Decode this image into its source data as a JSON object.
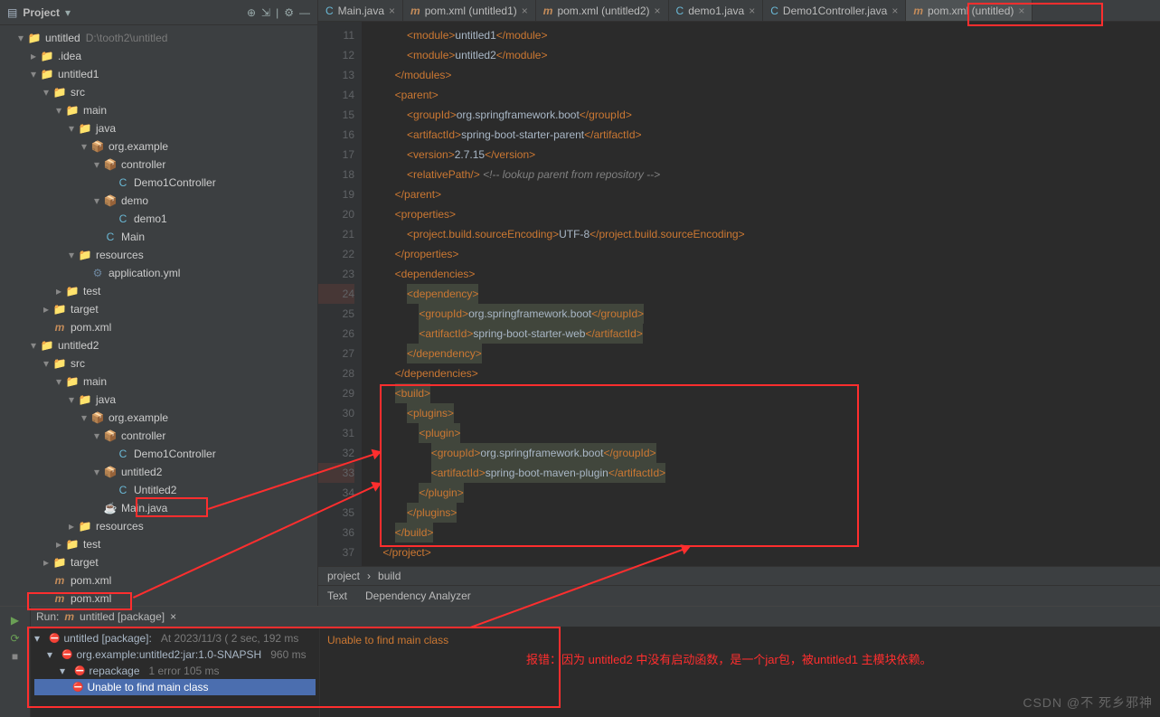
{
  "sidebar": {
    "title": "Project",
    "root": "untitled",
    "root_path": "D:\\tooth2\\untitled",
    "items": [
      {
        "ind": 0,
        "arrow": "▾",
        "icon": "📁",
        "iconCls": "folder-blue",
        "label": "untitled",
        "suffix": "D:\\tooth2\\untitled"
      },
      {
        "ind": 1,
        "arrow": "▸",
        "icon": "📁",
        "iconCls": "folder-blue",
        "label": ".idea"
      },
      {
        "ind": 1,
        "arrow": "▾",
        "icon": "📁",
        "iconCls": "folder-blue",
        "label": "untitled1"
      },
      {
        "ind": 2,
        "arrow": "▾",
        "icon": "📁",
        "iconCls": "folder-blue",
        "label": "src"
      },
      {
        "ind": 3,
        "arrow": "▾",
        "icon": "📁",
        "iconCls": "folder-blue",
        "label": "main"
      },
      {
        "ind": 4,
        "arrow": "▾",
        "icon": "📁",
        "iconCls": "folder-blue",
        "label": "java"
      },
      {
        "ind": 5,
        "arrow": "▾",
        "icon": "📦",
        "iconCls": "pkg",
        "label": "org.example"
      },
      {
        "ind": 6,
        "arrow": "▾",
        "icon": "📦",
        "iconCls": "pkg",
        "label": "controller"
      },
      {
        "ind": 7,
        "arrow": "",
        "icon": "C",
        "iconCls": "file-c",
        "label": "Demo1Controller"
      },
      {
        "ind": 6,
        "arrow": "▾",
        "icon": "📦",
        "iconCls": "pkg",
        "label": "demo"
      },
      {
        "ind": 7,
        "arrow": "",
        "icon": "C",
        "iconCls": "file-c",
        "label": "demo1"
      },
      {
        "ind": 6,
        "arrow": "",
        "icon": "C",
        "iconCls": "file-c",
        "label": "Main"
      },
      {
        "ind": 4,
        "arrow": "▾",
        "icon": "📁",
        "iconCls": "folder-org",
        "label": "resources"
      },
      {
        "ind": 5,
        "arrow": "",
        "icon": "⚙",
        "iconCls": "file-j",
        "label": "application.yml"
      },
      {
        "ind": 3,
        "arrow": "▸",
        "icon": "📁",
        "iconCls": "folder-blue",
        "label": "test"
      },
      {
        "ind": 2,
        "arrow": "▸",
        "icon": "📁",
        "iconCls": "folder-org",
        "label": "target"
      },
      {
        "ind": 2,
        "arrow": "",
        "icon": "m",
        "iconCls": "file-m",
        "label": "pom.xml"
      },
      {
        "ind": 1,
        "arrow": "▾",
        "icon": "📁",
        "iconCls": "folder-blue",
        "label": "untitled2"
      },
      {
        "ind": 2,
        "arrow": "▾",
        "icon": "📁",
        "iconCls": "folder-blue",
        "label": "src"
      },
      {
        "ind": 3,
        "arrow": "▾",
        "icon": "📁",
        "iconCls": "folder-blue",
        "label": "main"
      },
      {
        "ind": 4,
        "arrow": "▾",
        "icon": "📁",
        "iconCls": "folder-blue",
        "label": "java"
      },
      {
        "ind": 5,
        "arrow": "▾",
        "icon": "📦",
        "iconCls": "pkg",
        "label": "org.example"
      },
      {
        "ind": 6,
        "arrow": "▾",
        "icon": "📦",
        "iconCls": "pkg",
        "label": "controller"
      },
      {
        "ind": 7,
        "arrow": "",
        "icon": "C",
        "iconCls": "file-c",
        "label": "Demo1Controller"
      },
      {
        "ind": 6,
        "arrow": "▾",
        "icon": "📦",
        "iconCls": "pkg",
        "label": "untitled2"
      },
      {
        "ind": 7,
        "arrow": "",
        "icon": "C",
        "iconCls": "file-c",
        "label": "Untitled2"
      },
      {
        "ind": 6,
        "arrow": "",
        "icon": "☕",
        "iconCls": "file-j",
        "label": "Main.java"
      },
      {
        "ind": 4,
        "arrow": "▸",
        "icon": "📁",
        "iconCls": "folder-org",
        "label": "resources"
      },
      {
        "ind": 3,
        "arrow": "▸",
        "icon": "📁",
        "iconCls": "folder-blue",
        "label": "test"
      },
      {
        "ind": 2,
        "arrow": "▸",
        "icon": "📁",
        "iconCls": "folder-org",
        "label": "target"
      },
      {
        "ind": 2,
        "arrow": "",
        "icon": "m",
        "iconCls": "file-m",
        "label": "pom.xml"
      },
      {
        "ind": 2,
        "arrow": "",
        "icon": "m",
        "iconCls": "file-m",
        "label": "pom.xml"
      }
    ]
  },
  "tabs": [
    {
      "icon": "C",
      "iconCls": "file-c",
      "label": "Main.java"
    },
    {
      "icon": "m",
      "iconCls": "file-m",
      "label": "pom.xml (untitled1)"
    },
    {
      "icon": "m",
      "iconCls": "file-m",
      "label": "pom.xml (untitled2)"
    },
    {
      "icon": "C",
      "iconCls": "file-c",
      "label": "demo1.java"
    },
    {
      "icon": "C",
      "iconCls": "file-c",
      "label": "Demo1Controller.java"
    },
    {
      "icon": "m",
      "iconCls": "file-m",
      "label": "pom.xml (untitled)",
      "active": true
    }
  ],
  "code": {
    "startLine": 11,
    "lines": [
      {
        "n": 11,
        "html": "            <span class=t-tag>&lt;module&gt;</span>untitled1<span class=t-tag>&lt;/module&gt;</span>"
      },
      {
        "n": 12,
        "html": "            <span class=t-tag>&lt;module&gt;</span>untitled2<span class=t-tag>&lt;/module&gt;</span>"
      },
      {
        "n": 13,
        "html": "        <span class=t-tag>&lt;/modules&gt;</span>"
      },
      {
        "n": 14,
        "html": "        <span class=t-tag>&lt;parent&gt;</span>"
      },
      {
        "n": 15,
        "html": "            <span class=t-tag>&lt;groupId&gt;</span>org.springframework.boot<span class=t-tag>&lt;/groupId&gt;</span>"
      },
      {
        "n": 16,
        "html": "            <span class=t-tag>&lt;artifactId&gt;</span>spring-boot-starter-parent<span class=t-tag>&lt;/artifactId&gt;</span>"
      },
      {
        "n": 17,
        "html": "            <span class=t-tag>&lt;version&gt;</span>2.7.15<span class=t-tag>&lt;/version&gt;</span>"
      },
      {
        "n": 18,
        "html": "            <span class=t-tag>&lt;relativePath/&gt;</span> <span class=t-cmt>&lt;!-- lookup parent from repository --&gt;</span>"
      },
      {
        "n": 19,
        "html": "        <span class=t-tag>&lt;/parent&gt;</span>"
      },
      {
        "n": 20,
        "html": "        <span class=t-tag>&lt;properties&gt;</span>"
      },
      {
        "n": 21,
        "html": "            <span class=t-tag>&lt;project.build.sourceEncoding&gt;</span>UTF-8<span class=t-tag>&lt;/project.build.sourceEncoding&gt;</span>"
      },
      {
        "n": 22,
        "html": "        <span class=t-tag>&lt;/properties&gt;</span>"
      },
      {
        "n": 23,
        "html": "        <span class=t-tag>&lt;dependencies&gt;</span>"
      },
      {
        "n": 24,
        "html": "            <span class='hl'><span class=t-tag>&lt;dependency&gt;</span></span>"
      },
      {
        "n": 25,
        "html": "                <span class='hl'><span class=t-tag>&lt;groupId&gt;</span>org.springframework.boot<span class=t-tag>&lt;/groupId&gt;</span></span>"
      },
      {
        "n": 26,
        "html": "                <span class='hl'><span class=t-tag>&lt;artifactId&gt;</span>spring-boot-starter-web<span class=t-tag>&lt;/artifactId&gt;</span></span>"
      },
      {
        "n": 27,
        "html": "            <span class='hl'><span class=t-tag>&lt;/dependency&gt;</span></span>"
      },
      {
        "n": 28,
        "html": "        <span class=t-tag>&lt;/dependencies&gt;</span>"
      },
      {
        "n": 29,
        "html": "        <span class='hl'><span class=t-tag>&lt;build&gt;</span></span>"
      },
      {
        "n": 30,
        "html": "            <span class='hl'><span class=t-tag>&lt;plugins&gt;</span></span>"
      },
      {
        "n": 31,
        "html": "                <span class='hl'><span class=t-tag>&lt;plugin&gt;</span></span>"
      },
      {
        "n": 32,
        "html": "                    <span class='hl'><span class=t-tag>&lt;groupId&gt;</span>org.springframework.boot<span class=t-tag>&lt;/groupId&gt;</span></span>"
      },
      {
        "n": 33,
        "html": "                    <span class='hl'><span class=t-tag>&lt;artifactId&gt;</span>spring-boot-maven-plugin<span class=t-tag>&lt;/artifactId&gt;</span></span>"
      },
      {
        "n": 34,
        "html": "                <span class='hl'><span class=t-tag>&lt;/plugin&gt;</span></span>"
      },
      {
        "n": 35,
        "html": "            <span class='hl'><span class=t-tag>&lt;/plugins&gt;</span></span>"
      },
      {
        "n": 36,
        "html": "        <span class='hl'><span class=t-tag>&lt;/build&gt;</span></span>"
      },
      {
        "n": 37,
        "html": "    <span class=t-tag>&lt;/project&gt;</span>"
      }
    ]
  },
  "breadcrumb": {
    "a": "project",
    "b": "build"
  },
  "subtabs": {
    "a": "Text",
    "b": "Dependency Analyzer"
  },
  "run": {
    "tab": "untitled [package]",
    "tree": [
      {
        "ind": 0,
        "arrow": "▾",
        "err": true,
        "label": "untitled [package]:",
        "meta": "At 2023/11/3 ( 2 sec, 192 ms"
      },
      {
        "ind": 1,
        "arrow": "▾",
        "err": true,
        "label": "org.example:untitled2:jar:1.0-SNAPSH",
        "meta": "960 ms"
      },
      {
        "ind": 2,
        "arrow": "▾",
        "err": true,
        "label": "repackage",
        "meta": "1 error        105 ms"
      },
      {
        "ind": 3,
        "arrow": "",
        "err": true,
        "sel": true,
        "label": "Unable to find main class"
      }
    ],
    "msg": "Unable to find main class"
  },
  "annotation": "报错：因为 untitled2 中没有启动函数，是一个jar包，被untitled1 主模块依赖。",
  "watermark": "CSDN @不 死乡邪神"
}
